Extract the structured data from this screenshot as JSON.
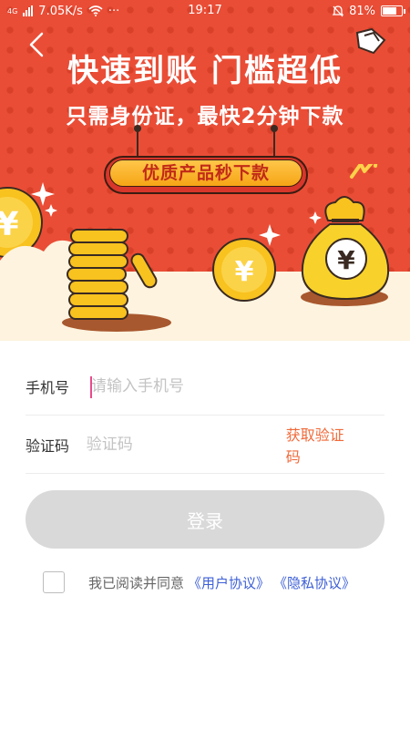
{
  "status_bar": {
    "network_type": "4G",
    "speed": "7.05K/s",
    "more": "···",
    "time": "19:17",
    "battery": "81%",
    "battery_level": 0.81
  },
  "banner": {
    "title": "快速到账 门槛超低",
    "subtitle": "只需身份证，最快2分钟下款",
    "pill_label": "优质产品秒下款",
    "currency_symbol": "¥"
  },
  "form": {
    "phone_label": "手机号",
    "phone_placeholder": "请输入手机号",
    "phone_value": "",
    "code_label": "验证码",
    "code_placeholder": "验证码",
    "code_value": "",
    "get_code_label": "获取验证码"
  },
  "login_label": "登录",
  "agreement": {
    "text": "我已阅读并同意",
    "user_agreement": "《用户协议》",
    "privacy_policy": "《隐私协议》",
    "checked": false
  },
  "colors": {
    "banner_red": "#ea4d36",
    "accent_orange": "#f06a3a",
    "link_blue": "#3d5fd6",
    "button_disabled": "#d9d9d9",
    "coin_gold": "#f8c21f"
  }
}
